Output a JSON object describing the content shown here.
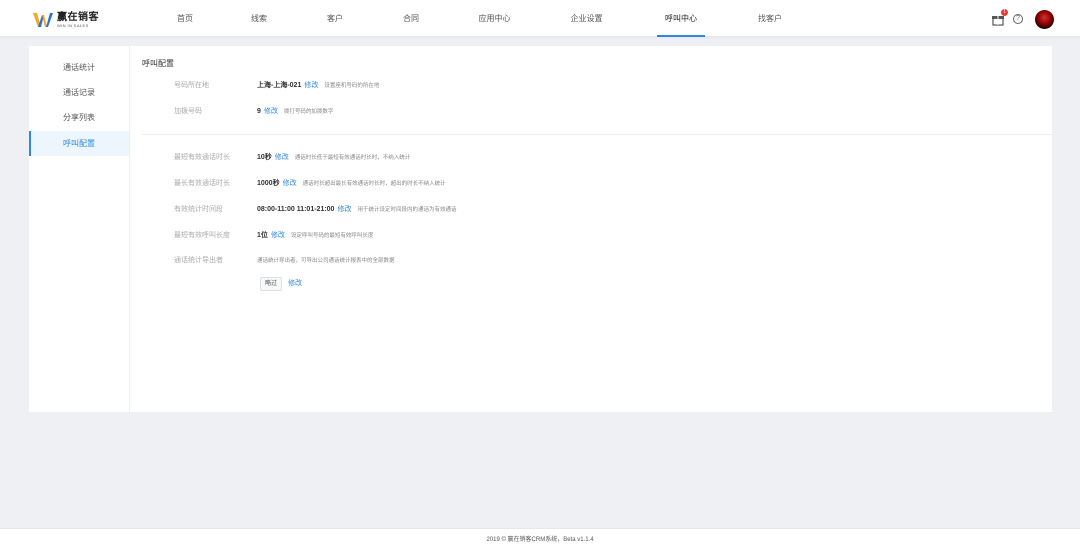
{
  "logo": {
    "name": "赢在销客",
    "subtitle": "WIN IN SALES"
  },
  "nav": {
    "items": [
      {
        "label": "首页"
      },
      {
        "label": "线索"
      },
      {
        "label": "客户"
      },
      {
        "label": "合同"
      },
      {
        "label": "应用中心"
      },
      {
        "label": "企业设置"
      },
      {
        "label": "呼叫中心",
        "active": true
      },
      {
        "label": "找客户"
      }
    ]
  },
  "header_right": {
    "gift_badge": "1",
    "help_label": "?"
  },
  "sidebar": {
    "items": [
      {
        "label": "通话统计"
      },
      {
        "label": "通话记录"
      },
      {
        "label": "分享列表"
      },
      {
        "label": "呼叫配置",
        "active": true
      }
    ]
  },
  "content": {
    "title": "呼叫配置",
    "edit_label": "修改",
    "rows": [
      {
        "label": "号码所在地",
        "value": "上海-上海-021",
        "hint": "设置座机号码的所在地"
      },
      {
        "label": "加拨号码",
        "value": "9",
        "hint": "拨打号码的加拨数字"
      },
      {
        "label": "最短有效通话时长",
        "value": "10秒",
        "hint": "通话时长低于最短有效通话时长时，不纳入统计"
      },
      {
        "label": "最长有效通话时长",
        "value": "1000秒",
        "hint": "通话时长超出最长有效通话时长时，超出的时长不纳入统计"
      },
      {
        "label": "有效统计时间段",
        "value": "08:00-11:00 11:01-21:00",
        "hint": "用于统计设定时间段内的通话为有效通话"
      },
      {
        "label": "最短有效呼叫长度",
        "value": "1位",
        "hint": "设定呼叫号码的最短有效呼叫长度"
      },
      {
        "label": "通话统计导出者",
        "value": "",
        "hint": "通话统计导出者，可导出公司通话统计报表中的全部数据"
      }
    ],
    "skip_button": "略过",
    "skip_edit": "修改"
  },
  "footer": {
    "text": "2019 © 赢在销客CRM系统，Beta v1.1.4"
  },
  "colors": {
    "accent": "#2f88e0",
    "badge": "#e53935",
    "logo_orange": "#f5a623",
    "logo_blue": "#2f6fd6"
  }
}
